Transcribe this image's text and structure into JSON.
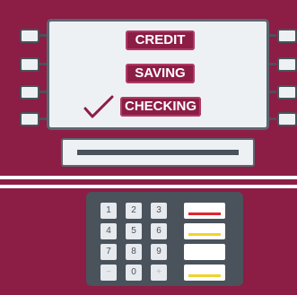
{
  "screen": {
    "options": [
      {
        "label": "CREDIT",
        "selected": false
      },
      {
        "label": "SAVING",
        "selected": false
      },
      {
        "label": "CHECKING",
        "selected": true
      }
    ],
    "selection_mark": "checkmark-icon"
  },
  "keypad": {
    "keys": [
      "1",
      "2",
      "3",
      "4",
      "5",
      "6",
      "7",
      "8",
      "9",
      "−",
      "0",
      "+"
    ],
    "function_keys": [
      "cancel",
      "clear",
      "blank",
      "enter"
    ]
  },
  "colors": {
    "body": "#8c1d45",
    "screen": "#eef1f4",
    "frame": "#4a525b",
    "cancel_line": "#e2232a",
    "clear_line": "#f2d22e",
    "enter_line": "#f2d22e"
  }
}
